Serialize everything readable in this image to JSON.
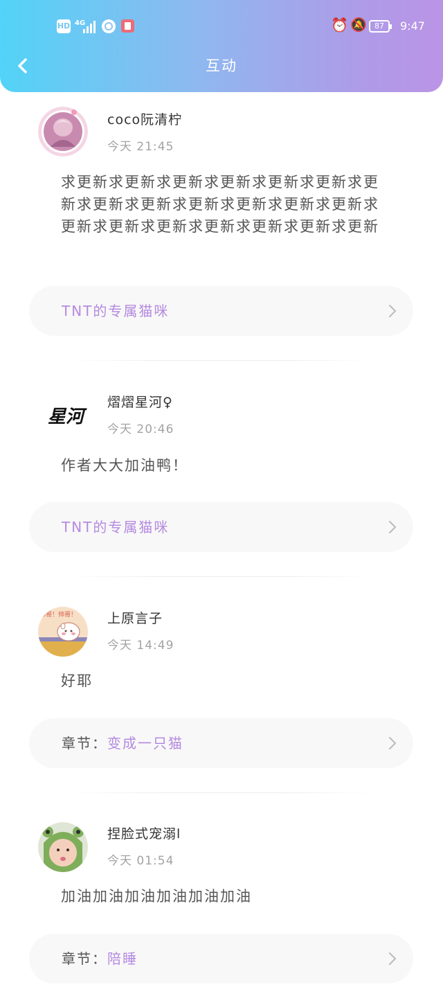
{
  "status_bar": {
    "hd": "HD",
    "network": "4G",
    "battery": "87",
    "time": "9:47"
  },
  "header": {
    "title": "互动",
    "back_icon": "chevron-left-icon"
  },
  "colors": {
    "header_gradient": [
      "#52d3f7",
      "#bb94e6"
    ],
    "accent": "#b48ae0",
    "source_bar_bg": "#f8f8f8"
  },
  "comments": [
    {
      "username": "coco阮清柠",
      "time": "今天 21:45",
      "text": "求更新求更新求更新求更新求更新求更新求更新求更新求更新求更新求更新求更新求更新求更新求更新求更新求更新求更新求更新求更新",
      "source_prefix": "",
      "source": "TNT的专属猫咪",
      "avatar_icon": "girl-portrait-avatar"
    },
    {
      "username": "熠熠星河♀",
      "time": "今天 20:46",
      "text": "作者大大加油鸭！",
      "source_prefix": "",
      "source": "TNT的专属猫咪",
      "avatar_icon": "calligraphy-avatar",
      "avatar_text": "星河"
    },
    {
      "username": "上原言子",
      "time": "今天 14:49",
      "text": "好耶",
      "source_prefix": "章节：",
      "source": "变成一只猫",
      "avatar_icon": "cartoon-cat-avatar",
      "avatar_text": "帅哥！帅哥！"
    },
    {
      "username": "捏脸式宠溺l",
      "time": "今天 01:54",
      "text": "加油加油加油加油加油加油",
      "source_prefix": "章节：",
      "source": "陪睡",
      "avatar_icon": "baby-portrait-avatar"
    }
  ]
}
